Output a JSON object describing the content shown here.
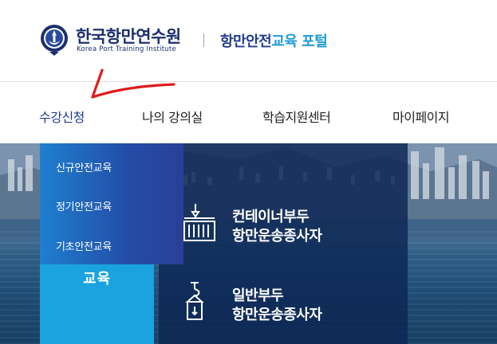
{
  "header": {
    "logo_korean": "한국항만연수원",
    "logo_english": "Korea Port Training Institute",
    "portal_part1": "항만안전",
    "portal_part2": "교육 포털"
  },
  "nav": {
    "items": [
      {
        "label": "수강신청",
        "active": true
      },
      {
        "label": "나의 강의실",
        "active": false
      },
      {
        "label": "학습지원센터",
        "active": false
      },
      {
        "label": "마이페이지",
        "active": false
      }
    ]
  },
  "dropdown": {
    "items": [
      {
        "label": "신규안전교육"
      },
      {
        "label": "정기안전교육"
      },
      {
        "label": "기초안전교육"
      }
    ]
  },
  "hero": {
    "left_tile_label": "교육",
    "cards": [
      {
        "line1": "컨테이너부두",
        "line2": "항만운송종사자",
        "icon": "container-crane-icon"
      },
      {
        "line1": "일반부두",
        "line2": "항만운송종사자",
        "icon": "cargo-hook-icon"
      }
    ]
  },
  "colors": {
    "brand_navy": "#1d2f6e",
    "portal_blue": "#243b8c",
    "portal_cyan": "#1e9bd7",
    "dropdown_blue": "#234ea8",
    "tile_cyan": "#1aa3df",
    "annotation_red": "#e01b1b"
  }
}
